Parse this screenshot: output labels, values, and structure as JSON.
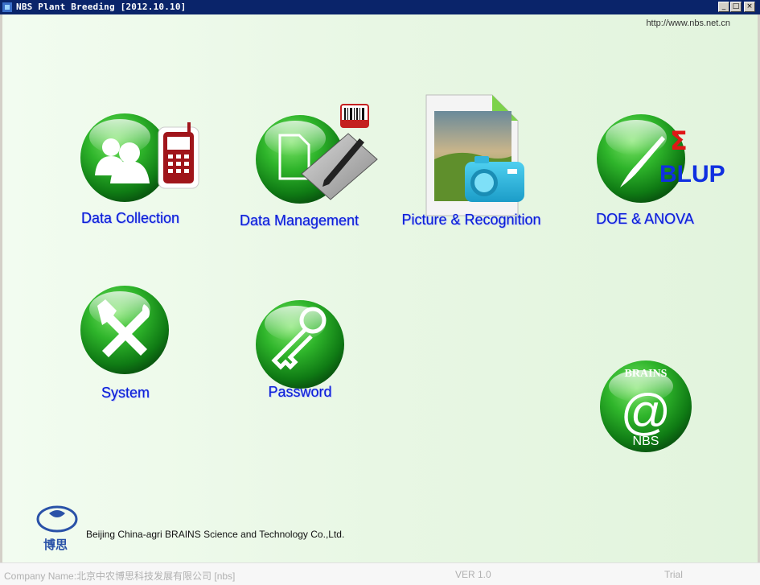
{
  "window": {
    "title": "NBS Plant Breeding [2012.10.10]",
    "buttons": {
      "minimize": "_",
      "maximize": "□",
      "close": "×"
    }
  },
  "header": {
    "url": "http://www.nbs.net.cn"
  },
  "tiles": {
    "data_collection": "Data Collection",
    "data_management": "Data Management",
    "picture_recognition": "Picture & Recognition",
    "doe_anova": "DOE & ANOVA",
    "system": "System",
    "password": "Password"
  },
  "blup": {
    "sigma": "Σ",
    "text": "BLUP"
  },
  "nbs_logo": {
    "ring_text": "BRAINS",
    "at": "@",
    "nbs": "NBS"
  },
  "footer": {
    "logo_chars": "博思",
    "company_line": "Beijing China-agri BRAINS Science and Technology Co.,Ltd."
  },
  "status": {
    "company_name": "Company Name:北京中农博思科技发展有限公司  [nbs]",
    "version": "VER 1.0",
    "license": "Trial"
  },
  "icons": [
    "people-icon",
    "phone-icon",
    "document-icon",
    "pen-icon",
    "barcode-icon",
    "landscape-photo-icon",
    "camera-icon",
    "brush-icon",
    "tools-icon",
    "key-icon",
    "nbs-logo-icon",
    "boshi-logo-icon"
  ]
}
